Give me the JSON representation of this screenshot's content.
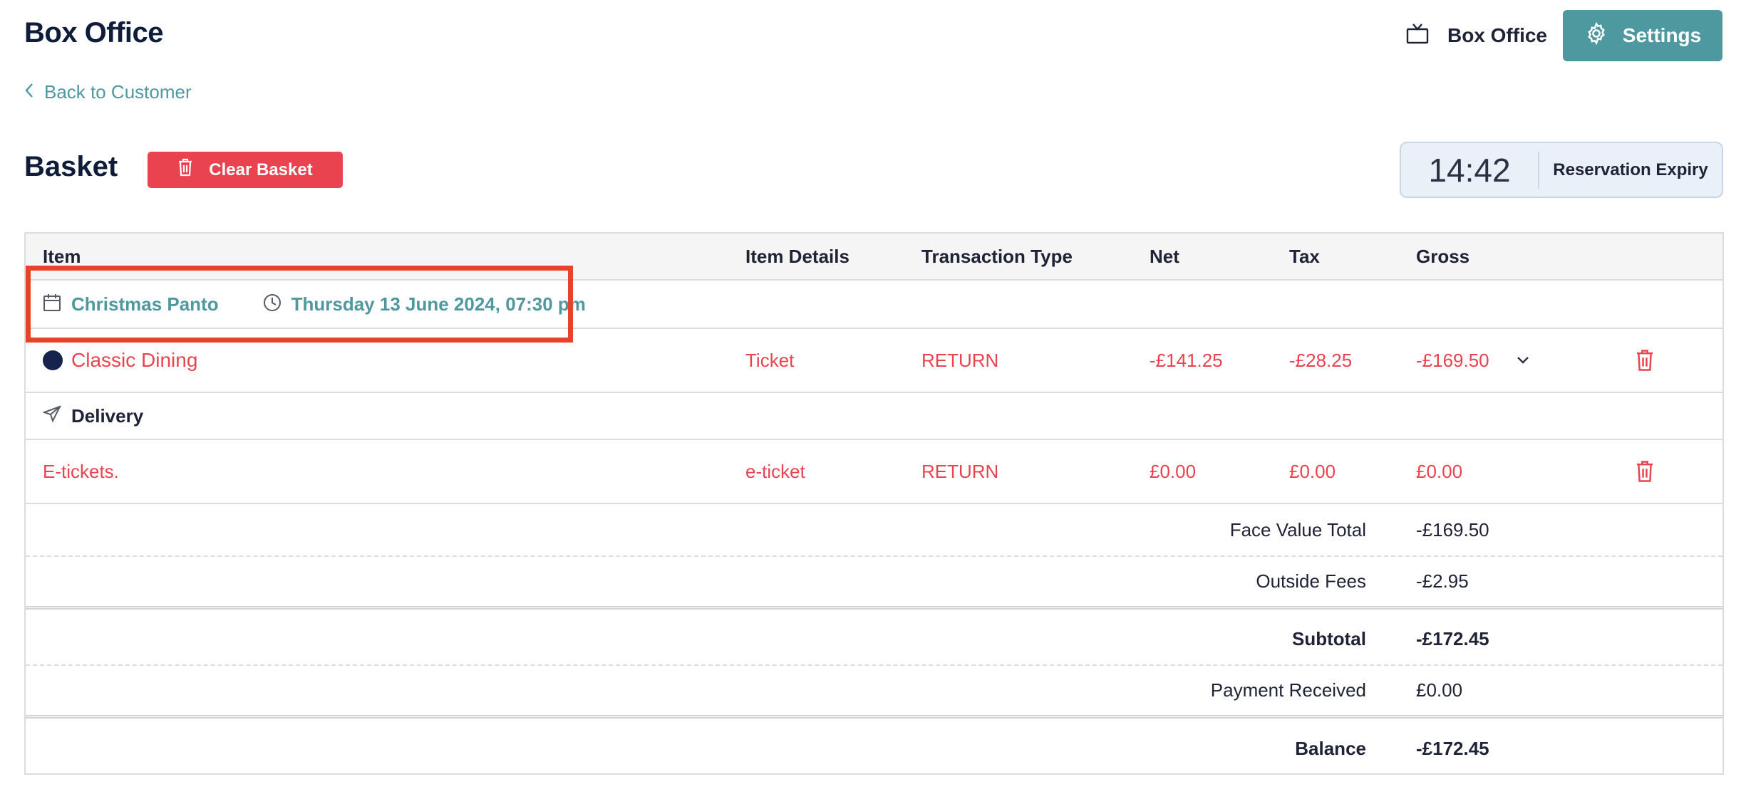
{
  "header": {
    "title": "Box Office",
    "box_office_label": "Box Office",
    "settings_label": "Settings",
    "back_label": "Back to Customer"
  },
  "basket": {
    "title": "Basket",
    "clear_label": "Clear Basket",
    "timer": "14:42",
    "timer_label": "Reservation Expiry"
  },
  "table": {
    "columns": [
      "Item",
      "Item Details",
      "Transaction Type",
      "Net",
      "Tax",
      "Gross"
    ],
    "event": {
      "name": "Christmas Panto",
      "datetime": "Thursday 13 June 2024, 07:30 pm"
    },
    "items": [
      {
        "name": "Classic Dining",
        "details": "Ticket",
        "type": "RETURN",
        "net": "-£141.25",
        "tax": "-£28.25",
        "gross": "-£169.50"
      }
    ],
    "delivery_label": "Delivery",
    "delivery_items": [
      {
        "name": "E-tickets.",
        "details": "e-ticket",
        "type": "RETURN",
        "net": "£0.00",
        "tax": "£0.00",
        "gross": "£0.00"
      }
    ],
    "summary": {
      "face_value_label": "Face Value Total",
      "face_value": "-£169.50",
      "outside_fees_label": "Outside Fees",
      "outside_fees": "-£2.95",
      "subtotal_label": "Subtotal",
      "subtotal": "-£172.45",
      "payment_label": "Payment Received",
      "payment": "£0.00",
      "balance_label": "Balance",
      "balance": "-£172.45"
    }
  },
  "colors": {
    "accent": "#4e98a0",
    "danger": "#e8434f",
    "navy": "#0f1d3a",
    "highlight": "#e8432a"
  },
  "icons": [
    "tv-icon",
    "gear-icon",
    "chevron-left-icon",
    "trash-icon",
    "calendar-icon",
    "clock-icon",
    "paper-plane-icon",
    "chevron-down-icon"
  ]
}
